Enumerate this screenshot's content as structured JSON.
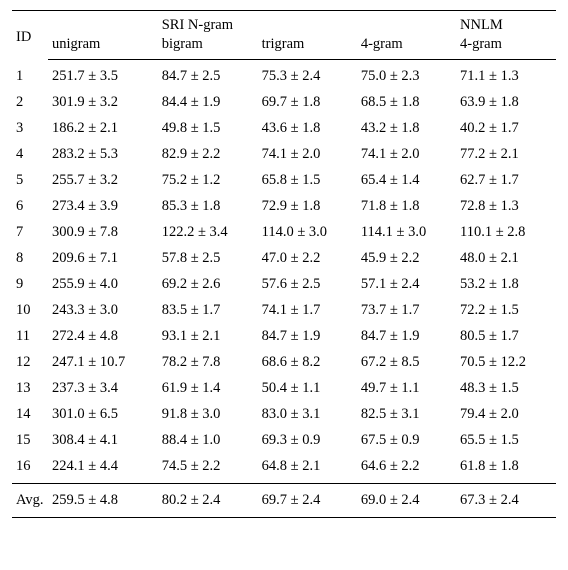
{
  "header": {
    "group_sri": "SRI N-gram",
    "group_nn": "NNLM",
    "id": "ID",
    "cols": [
      "unigram",
      "bigram",
      "trigram",
      "4-gram",
      "4-gram"
    ]
  },
  "rows": [
    {
      "id": "1",
      "c": [
        "251.7 ± 3.5",
        "84.7 ± 2.5",
        "75.3 ± 2.4",
        "75.0 ± 2.3",
        "71.1 ± 1.3"
      ]
    },
    {
      "id": "2",
      "c": [
        "301.9 ± 3.2",
        "84.4 ± 1.9",
        "69.7 ± 1.8",
        "68.5 ± 1.8",
        "63.9 ± 1.8"
      ]
    },
    {
      "id": "3",
      "c": [
        "186.2 ± 2.1",
        "49.8 ± 1.5",
        "43.6 ± 1.8",
        "43.2 ± 1.8",
        "40.2 ± 1.7"
      ]
    },
    {
      "id": "4",
      "c": [
        "283.2 ± 5.3",
        "82.9 ± 2.2",
        "74.1 ± 2.0",
        "74.1 ± 2.0",
        "77.2 ± 2.1"
      ]
    },
    {
      "id": "5",
      "c": [
        "255.7 ± 3.2",
        "75.2 ± 1.2",
        "65.8 ± 1.5",
        "65.4 ± 1.4",
        "62.7 ± 1.7"
      ]
    },
    {
      "id": "6",
      "c": [
        "273.4 ± 3.9",
        "85.3 ± 1.8",
        "72.9 ± 1.8",
        "71.8 ± 1.8",
        "72.8 ± 1.3"
      ]
    },
    {
      "id": "7",
      "c": [
        "300.9 ± 7.8",
        "122.2 ± 3.4",
        "114.0 ± 3.0",
        "114.1 ± 3.0",
        "110.1 ± 2.8"
      ]
    },
    {
      "id": "8",
      "c": [
        "209.6 ± 7.1",
        "57.8 ± 2.5",
        "47.0 ± 2.2",
        "45.9 ± 2.2",
        "48.0 ± 2.1"
      ]
    },
    {
      "id": "9",
      "c": [
        "255.9 ± 4.0",
        "69.2 ± 2.6",
        "57.6 ± 2.5",
        "57.1 ± 2.4",
        "53.2 ± 1.8"
      ]
    },
    {
      "id": "10",
      "c": [
        "243.3 ± 3.0",
        "83.5 ± 1.7",
        "74.1 ± 1.7",
        "73.7 ± 1.7",
        "72.2 ± 1.5"
      ]
    },
    {
      "id": "11",
      "c": [
        "272.4 ± 4.8",
        "93.1 ± 2.1",
        "84.7 ± 1.9",
        "84.7 ± 1.9",
        "80.5 ± 1.7"
      ]
    },
    {
      "id": "12",
      "c": [
        "247.1 ± 10.7",
        "78.2 ± 7.8",
        "68.6 ± 8.2",
        "67.2 ± 8.5",
        "70.5 ± 12.2"
      ]
    },
    {
      "id": "13",
      "c": [
        "237.3 ± 3.4",
        "61.9 ± 1.4",
        "50.4 ± 1.1",
        "49.7 ± 1.1",
        "48.3 ± 1.5"
      ]
    },
    {
      "id": "14",
      "c": [
        "301.0 ± 6.5",
        "91.8 ± 3.0",
        "83.0 ± 3.1",
        "82.5 ± 3.1",
        "79.4 ± 2.0"
      ]
    },
    {
      "id": "15",
      "c": [
        "308.4 ± 4.1",
        "88.4 ± 1.0",
        "69.3 ± 0.9",
        "67.5 ± 0.9",
        "65.5 ± 1.5"
      ]
    },
    {
      "id": "16",
      "c": [
        "224.1 ± 4.4",
        "74.5 ± 2.2",
        "64.8 ± 2.1",
        "64.6 ± 2.2",
        "61.8 ± 1.8"
      ]
    }
  ],
  "footer": {
    "label": "Avg.",
    "c": [
      "259.5 ± 4.8",
      "80.2 ± 2.4",
      "69.7 ± 2.4",
      "69.0 ± 2.4",
      "67.3 ± 2.4"
    ]
  },
  "chart_data": {
    "type": "table",
    "title": "",
    "columns": [
      "ID",
      "SRI unigram",
      "SRI bigram",
      "SRI trigram",
      "SRI 4-gram",
      "NNLM 4-gram"
    ],
    "series": [
      {
        "name": "SRI unigram",
        "values": [
          251.7,
          301.9,
          186.2,
          283.2,
          255.7,
          273.4,
          300.9,
          209.6,
          255.9,
          243.3,
          272.4,
          247.1,
          237.3,
          301.0,
          308.4,
          224.1
        ],
        "errors": [
          3.5,
          3.2,
          2.1,
          5.3,
          3.2,
          3.9,
          7.8,
          7.1,
          4.0,
          3.0,
          4.8,
          10.7,
          3.4,
          6.5,
          4.1,
          4.4
        ]
      },
      {
        "name": "SRI bigram",
        "values": [
          84.7,
          84.4,
          49.8,
          82.9,
          75.2,
          85.3,
          122.2,
          57.8,
          69.2,
          83.5,
          93.1,
          78.2,
          61.9,
          91.8,
          88.4,
          74.5
        ],
        "errors": [
          2.5,
          1.9,
          1.5,
          2.2,
          1.2,
          1.8,
          3.4,
          2.5,
          2.6,
          1.7,
          2.1,
          7.8,
          1.4,
          3.0,
          1.0,
          2.2
        ]
      },
      {
        "name": "SRI trigram",
        "values": [
          75.3,
          69.7,
          43.6,
          74.1,
          65.8,
          72.9,
          114.0,
          47.0,
          57.6,
          74.1,
          84.7,
          68.6,
          50.4,
          83.0,
          69.3,
          64.8
        ],
        "errors": [
          2.4,
          1.8,
          1.8,
          2.0,
          1.5,
          1.8,
          3.0,
          2.2,
          2.5,
          1.7,
          1.9,
          8.2,
          1.1,
          3.1,
          0.9,
          2.1
        ]
      },
      {
        "name": "SRI 4-gram",
        "values": [
          75.0,
          68.5,
          43.2,
          74.1,
          65.4,
          71.8,
          114.1,
          45.9,
          57.1,
          73.7,
          84.7,
          67.2,
          49.7,
          82.5,
          67.5,
          64.6
        ],
        "errors": [
          2.3,
          1.8,
          1.8,
          2.0,
          1.4,
          1.8,
          3.0,
          2.2,
          2.4,
          1.7,
          1.9,
          8.5,
          1.1,
          3.1,
          0.9,
          2.2
        ]
      },
      {
        "name": "NNLM 4-gram",
        "values": [
          71.1,
          63.9,
          40.2,
          77.2,
          62.7,
          72.8,
          110.1,
          48.0,
          53.2,
          72.2,
          80.5,
          70.5,
          48.3,
          79.4,
          65.5,
          61.8
        ],
        "errors": [
          1.3,
          1.8,
          1.7,
          2.1,
          1.7,
          1.3,
          2.8,
          2.1,
          1.8,
          1.5,
          1.7,
          12.2,
          1.5,
          2.0,
          1.5,
          1.8
        ]
      }
    ],
    "categories": [
      1,
      2,
      3,
      4,
      5,
      6,
      7,
      8,
      9,
      10,
      11,
      12,
      13,
      14,
      15,
      16
    ],
    "summary": {
      "label": "Avg.",
      "values": [
        259.5,
        80.2,
        69.7,
        69.0,
        67.3
      ],
      "errors": [
        4.8,
        2.4,
        2.4,
        2.4,
        2.4
      ]
    }
  }
}
